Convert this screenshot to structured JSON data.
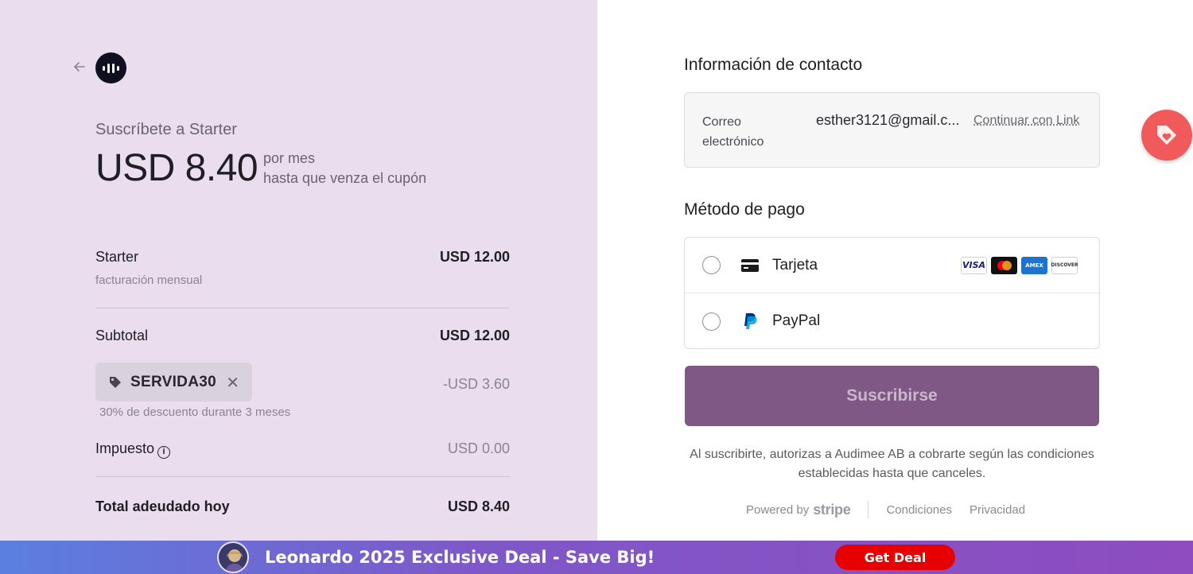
{
  "summary": {
    "back_icon": "arrow-left-icon",
    "logo_icon": "brand-logo",
    "subscribe_title": "Suscríbete a Starter",
    "price": "USD 8.40",
    "price_period": "por mes",
    "price_condition": "hasta que venza el cupón",
    "line_item": {
      "name": "Starter",
      "note": "facturación mensual",
      "amount": "USD 12.00"
    },
    "subtotal": {
      "label": "Subtotal",
      "amount": "USD 12.00"
    },
    "coupon": {
      "code": "SERVIDA30",
      "discount": "-USD 3.60",
      "note": "30% de descuento durante 3 meses"
    },
    "tax": {
      "label": "Impuesto",
      "amount": "USD 0.00"
    },
    "total": {
      "label": "Total adeudado hoy",
      "amount": "USD 8.40"
    }
  },
  "checkout": {
    "contact_heading": "Información de contacto",
    "email_label": "Correo electrónico",
    "email_value": "esther3121@gmail.c...",
    "link_button": "Continuar con Link",
    "payment_heading": "Método de pago",
    "methods": [
      {
        "label": "Tarjeta",
        "icon": "credit-card-icon"
      },
      {
        "label": "PayPal",
        "icon": "paypal-icon"
      }
    ],
    "card_brands": [
      "VISA",
      "Mastercard",
      "AMEX",
      "DISCOVER"
    ],
    "subscribe_button": "Suscribirse",
    "terms": "Al suscribirte, autorizas a Audimee AB a cobrarte según las condiciones establecidas hasta que canceles.",
    "powered_by": "Powered by",
    "stripe": "stripe",
    "conditions_link": "Condiciones",
    "privacy_link": "Privacidad"
  },
  "banner": {
    "text": "Leonardo 2025 Exclusive Deal - Save Big!",
    "button": "Get Deal"
  },
  "colors": {
    "left_bg": "#e9ddee",
    "button": "#7f5886",
    "banner_start": "#5b7fe0",
    "banner_end": "#8e4cc0",
    "deal_button": "#e60000"
  }
}
